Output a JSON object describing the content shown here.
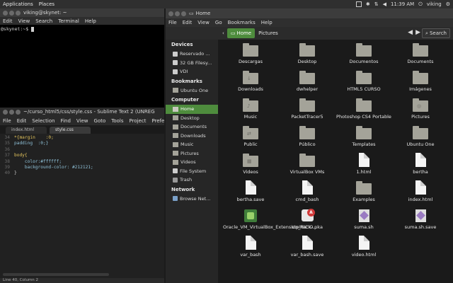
{
  "top_panel": {
    "menus": [
      "Applications",
      "Places"
    ],
    "time": "11:39 AM",
    "user": "viking"
  },
  "terminal": {
    "title": "viking@skynet: ~",
    "menus": [
      "Edit",
      "View",
      "Search",
      "Terminal",
      "Help"
    ],
    "prompt": "@skynet:~$"
  },
  "sublime": {
    "title": "~/curso_html5/css/style.css - Sublime Text 2 (UNREG",
    "menus": [
      "File",
      "Edit",
      "Selection",
      "Find",
      "View",
      "Goto",
      "Tools",
      "Project",
      "Preferen"
    ],
    "tabs": [
      "index.html",
      "style.css"
    ],
    "lines": [
      {
        "n": "34",
        "text": "*{margin    :0;"
      },
      {
        "n": "35",
        "text": "padding  :0;}"
      },
      {
        "n": "36",
        "text": ""
      },
      {
        "n": "37",
        "text": "body{"
      },
      {
        "n": "38",
        "text": "    color:#ffffff;"
      },
      {
        "n": "39",
        "text": "    background-color: #212121;"
      },
      {
        "n": "40",
        "text": "}"
      }
    ],
    "status": "Line 40, Column 2"
  },
  "file_manager": {
    "title": "Home",
    "menus": [
      "File",
      "Edit",
      "View",
      "Go",
      "Bookmarks",
      "Help"
    ],
    "breadcrumbs": [
      "Home",
      "Pictures"
    ],
    "search_label": "Search",
    "sidebar": {
      "devices_header": "Devices",
      "devices": [
        "Reservado ...",
        "32 GB Filesy...",
        "VDI"
      ],
      "bookmarks_header": "Bookmarks",
      "bookmarks": [
        "Ubuntu One"
      ],
      "computer_header": "Computer",
      "computer": [
        "Home",
        "Desktop",
        "Documents",
        "Downloads",
        "Music",
        "Pictures",
        "Videos",
        "File System",
        "Trash"
      ],
      "network_header": "Network",
      "network": [
        "Browse Net..."
      ]
    },
    "files": [
      {
        "name": "Descargas",
        "kind": "folder",
        "emblem": ""
      },
      {
        "name": "Desktop",
        "kind": "folder",
        "emblem": ""
      },
      {
        "name": "Documentos",
        "kind": "folder",
        "emblem": ""
      },
      {
        "name": "Documents",
        "kind": "folder",
        "emblem": ""
      },
      {
        "name": "Downloads",
        "kind": "folder",
        "emblem": "↓"
      },
      {
        "name": "dwhelper",
        "kind": "folder",
        "emblem": ""
      },
      {
        "name": "HTML5 CURSO",
        "kind": "folder",
        "emblem": ""
      },
      {
        "name": "Imágenes",
        "kind": "folder",
        "emblem": ""
      },
      {
        "name": "Music",
        "kind": "folder",
        "emblem": "♪"
      },
      {
        "name": "PacketTracer5",
        "kind": "folder",
        "emblem": ""
      },
      {
        "name": "Photoshop CS4 Portable",
        "kind": "folder",
        "emblem": ""
      },
      {
        "name": "Pictures",
        "kind": "folder",
        "emblem": "◎"
      },
      {
        "name": "Public",
        "kind": "folder",
        "emblem": "⇄"
      },
      {
        "name": "Público",
        "kind": "folder",
        "emblem": ""
      },
      {
        "name": "Templates",
        "kind": "folder",
        "emblem": ""
      },
      {
        "name": "Ubuntu One",
        "kind": "folder",
        "emblem": ""
      },
      {
        "name": "Videos",
        "kind": "folder",
        "emblem": "▦"
      },
      {
        "name": "VirtualBox VMs",
        "kind": "folder",
        "emblem": ""
      },
      {
        "name": "1.html",
        "kind": "doc",
        "emblem": ""
      },
      {
        "name": "bertha",
        "kind": "doc",
        "emblem": ""
      },
      {
        "name": "bertha.save",
        "kind": "doc",
        "emblem": ""
      },
      {
        "name": "cmd_bash",
        "kind": "doc",
        "emblem": ""
      },
      {
        "name": "Examples",
        "kind": "folder",
        "emblem": ""
      },
      {
        "name": "index.html",
        "kind": "doc",
        "emblem": ""
      },
      {
        "name": "Oracle_VM_VirtualBox_Extension_Pack-...",
        "kind": "exec",
        "emblem": ""
      },
      {
        "name": "stpINICIO.pka",
        "kind": "pka",
        "emblem": "A"
      },
      {
        "name": "suma.sh",
        "kind": "script",
        "emblem": ""
      },
      {
        "name": "suma.sh.save",
        "kind": "script",
        "emblem": ""
      },
      {
        "name": "var_bash",
        "kind": "doc",
        "emblem": ""
      },
      {
        "name": "var_bash.save",
        "kind": "doc",
        "emblem": ""
      },
      {
        "name": "video.html",
        "kind": "doc",
        "emblem": ""
      }
    ]
  }
}
